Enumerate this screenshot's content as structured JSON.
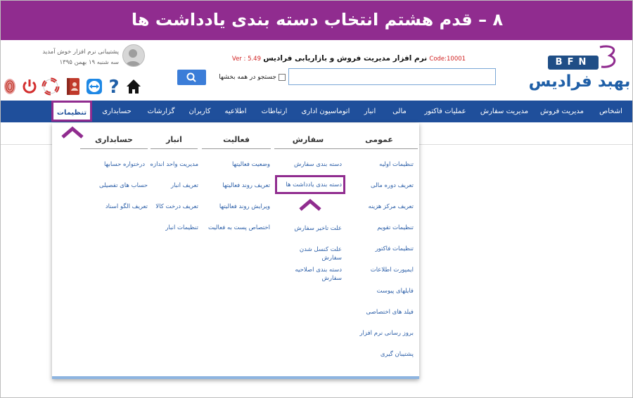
{
  "banner": {
    "title": "۸ – قدم هشتم انتخاب دسته بندی یادداشت ها"
  },
  "logo": {
    "bfn": "BFN",
    "name": "بهبد فرادیس"
  },
  "header": {
    "code": "Code:10001",
    "app_title": "نرم افزار مدیریت فروش و بازاریابی فرادیس",
    "version": "Ver : 5.49",
    "search_value": "",
    "search_all_label": "جستجو در همه بخشها",
    "user_greeting": "پشتیبانی نرم افزار خوش آمدید",
    "user_date": "سه شنبه ۱۹ بهمن ۱۳۹۵"
  },
  "toolbar": {
    "icons": [
      "home-icon",
      "help-icon",
      "teamviewer-icon",
      "contacts-book-icon",
      "lifebuoy-icon",
      "power-icon",
      "fingerprint-icon"
    ]
  },
  "nav": {
    "items": [
      "اشخاص",
      "مدیریت فروش",
      "مدیریت سفارش",
      "عملیات فاکتور",
      "مالی",
      "انبار",
      "اتوماسیون اداری",
      "ارتباطات",
      "اطلاعیه",
      "کاربران",
      "گزارشات",
      "حسابداری",
      "تنظیمات"
    ],
    "active": "تنظیمات"
  },
  "menu": {
    "general": {
      "title": "عمومی",
      "items": [
        "تنظیمات اولیه",
        "تعریف دوره مالی",
        "تعریف مرکز هزینه",
        "تنظیمات تقویم",
        "تنظیمات فاکتور",
        "ایمپورت اطلاعات",
        "فایلهای پیوست",
        "فیلد های اختصاصی",
        "بروز رسانی نرم افزار",
        "پشتیبان گیری"
      ]
    },
    "order": {
      "title": "سفارش",
      "items": [
        "دسته بندی سفارش",
        "دسته بندی یادداشت ها",
        "علت تاخیر سفارش",
        "علت کنسل شدن سفارش",
        "دسته بندی اصلاحیه سفارش"
      ]
    },
    "activity": {
      "title": "فعالیت",
      "items": [
        "وضعیت فعالیتها",
        "تعریف روند فعالیتها",
        "ویرایش روند فعالیتها",
        "اختصاص پست به فعالیت"
      ]
    },
    "warehouse": {
      "title": "انبار",
      "items": [
        "مدیریت واحد اندازه",
        "تعریف انبار",
        "تعریف درخت کالا",
        "تنظیمات انبار"
      ]
    },
    "accounting": {
      "title": "حسابداری",
      "items": [
        "درختواره حسابها",
        "حساب های تفصیلی",
        "تعریف الگو اسناد"
      ]
    }
  },
  "colors": {
    "banner": "#902c8f",
    "nav": "#1f4f9b",
    "link": "#2c5fa8",
    "highlight": "#902c8f"
  }
}
